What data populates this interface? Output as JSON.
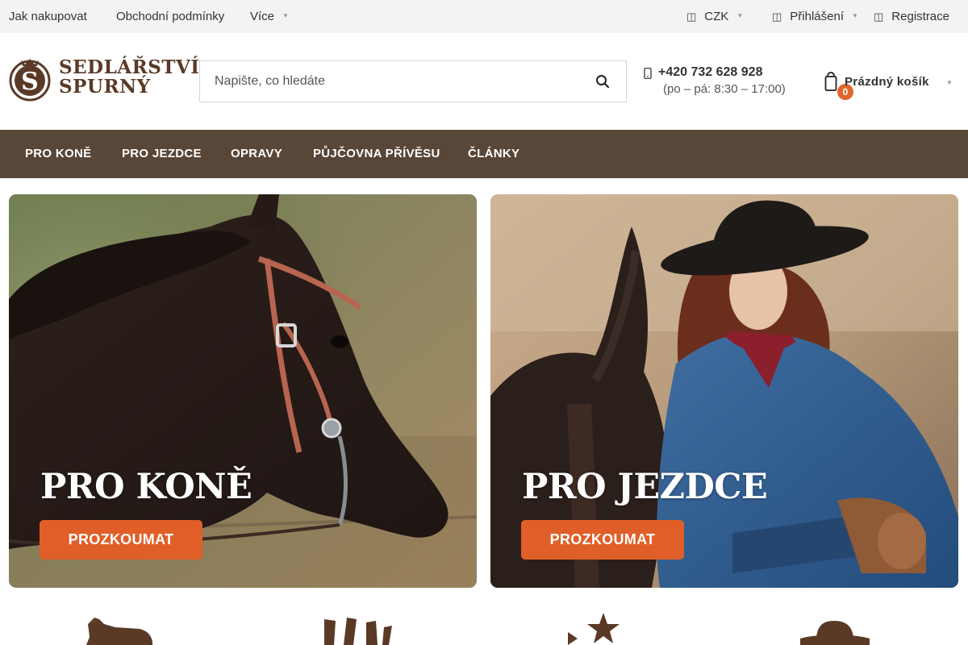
{
  "topbar": {
    "links": [
      "Jak nakupovat",
      "Obchodní podmínky"
    ],
    "more_label": "Více",
    "currency": "CZK",
    "login": "Přihlášení",
    "register": "Registrace"
  },
  "logo": {
    "line1": "SEDLÁŘSTVÍ",
    "line2": "SPURNÝ"
  },
  "search": {
    "placeholder": "Napište, co hledáte"
  },
  "contact": {
    "phone": "+420 732 628 928",
    "hours": "(po – pá: 8:30 – 17:00)"
  },
  "cart": {
    "label": "Prázdný košík",
    "count": "0"
  },
  "nav": {
    "items": [
      "PRO KONĚ",
      "PRO JEZDCE",
      "OPRAVY",
      "PŮJČOVNA PŘÍVĚSU",
      "ČLÁNKY"
    ]
  },
  "banners": [
    {
      "title": "PRO KONĚ",
      "button": "PROZKOUMAT"
    },
    {
      "title": "PRO JEZDCE",
      "button": "PROZKOUMAT"
    }
  ],
  "colors": {
    "accent": "#e05f28",
    "nav_bg": "#584638",
    "brand": "#5a3a27"
  },
  "icons": [
    "currency-icon",
    "user-icon",
    "register-icon",
    "search-icon",
    "phone-icon",
    "cart-icon",
    "horse-icon",
    "boots-icon",
    "sheriff-star-icon",
    "cowboy-hat-icon"
  ]
}
